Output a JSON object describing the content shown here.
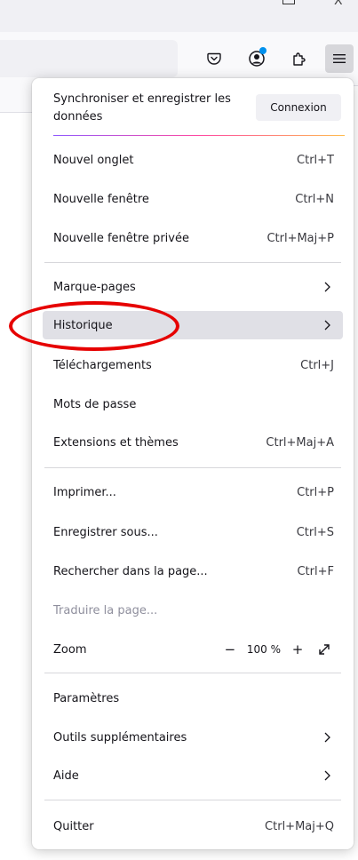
{
  "window": {
    "maximize_icon": "maximize-icon",
    "close_glyph": "X"
  },
  "toolbar": {
    "pocket_icon": "pocket-icon",
    "account_icon": "account-icon",
    "extensions_icon": "extensions-icon",
    "menu_icon": "hamburger-menu-icon",
    "accent_color": "#0090ed"
  },
  "menu": {
    "sync_text": "Synchroniser et enregistrer les données",
    "connexion_label": "Connexion",
    "items": [
      {
        "label": "Nouvel onglet",
        "shortcut": "Ctrl+T"
      },
      {
        "label": "Nouvelle fenêtre",
        "shortcut": "Ctrl+N"
      },
      {
        "label": "Nouvelle fenêtre privée",
        "shortcut": "Ctrl+Maj+P"
      },
      {
        "label": "Marque-pages",
        "shortcut": ""
      },
      {
        "label": "Historique",
        "shortcut": ""
      },
      {
        "label": "Téléchargements",
        "shortcut": "Ctrl+J"
      },
      {
        "label": "Mots de passe",
        "shortcut": ""
      },
      {
        "label": "Extensions et thèmes",
        "shortcut": "Ctrl+Maj+A"
      },
      {
        "label": "Imprimer...",
        "shortcut": "Ctrl+P"
      },
      {
        "label": "Enregistrer sous...",
        "shortcut": "Ctrl+S"
      },
      {
        "label": "Rechercher dans la page...",
        "shortcut": "Ctrl+F"
      },
      {
        "label": "Traduire la page...",
        "shortcut": ""
      },
      {
        "label": "Zoom",
        "shortcut": ""
      },
      {
        "label": "Paramètres",
        "shortcut": ""
      },
      {
        "label": "Outils supplémentaires",
        "shortcut": ""
      },
      {
        "label": "Aide",
        "shortcut": ""
      },
      {
        "label": "Quitter",
        "shortcut": "Ctrl+Maj+Q"
      }
    ],
    "zoom": {
      "minus": "−",
      "value": "100 %",
      "plus": "+"
    }
  },
  "annotation": {
    "color": "#e60000",
    "target": "Historique"
  }
}
